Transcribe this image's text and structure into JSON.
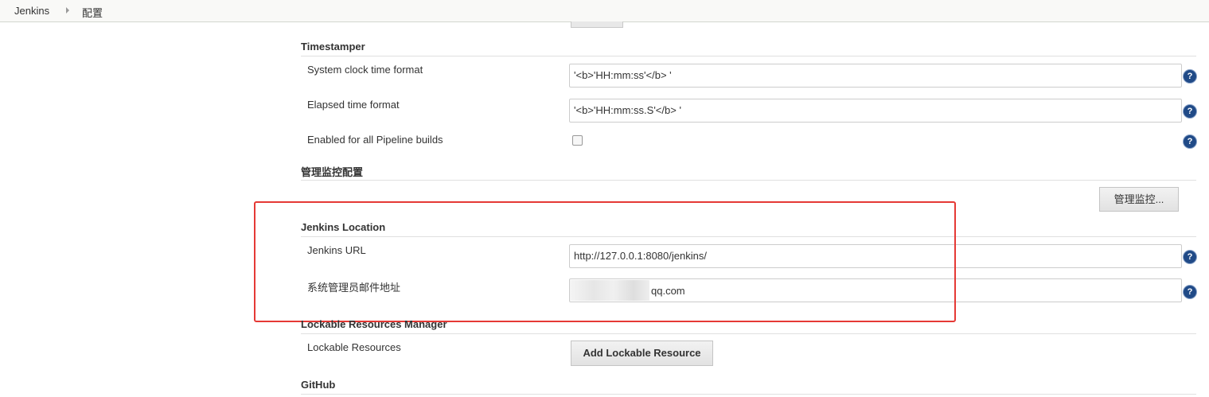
{
  "breadcrumb": {
    "root": "Jenkins",
    "current": "配置"
  },
  "timestamper": {
    "title": "Timestamper",
    "system_clock_label": "System clock time format",
    "system_clock_value": "'<b>'HH:mm:ss'</b> '",
    "elapsed_label": "Elapsed time format",
    "elapsed_value": "'<b>'HH:mm:ss.S'</b> '",
    "pipeline_label": "Enabled for all Pipeline builds",
    "pipeline_checked": false
  },
  "monitor": {
    "title": "管理监控配置",
    "button_label": "管理监控..."
  },
  "location": {
    "title": "Jenkins Location",
    "url_label": "Jenkins URL",
    "url_value": "http://127.0.0.1:8080/jenkins/",
    "email_label": "系统管理员邮件地址",
    "email_visible_suffix": "qq.com"
  },
  "lockable": {
    "title": "Lockable Resources Manager",
    "resources_label": "Lockable Resources",
    "add_button_label": "Add Lockable Resource"
  },
  "github": {
    "title": "GitHub"
  },
  "help_icon_glyph": "?",
  "colors": {
    "highlight": "#e53935",
    "help_icon": "#204a87"
  }
}
